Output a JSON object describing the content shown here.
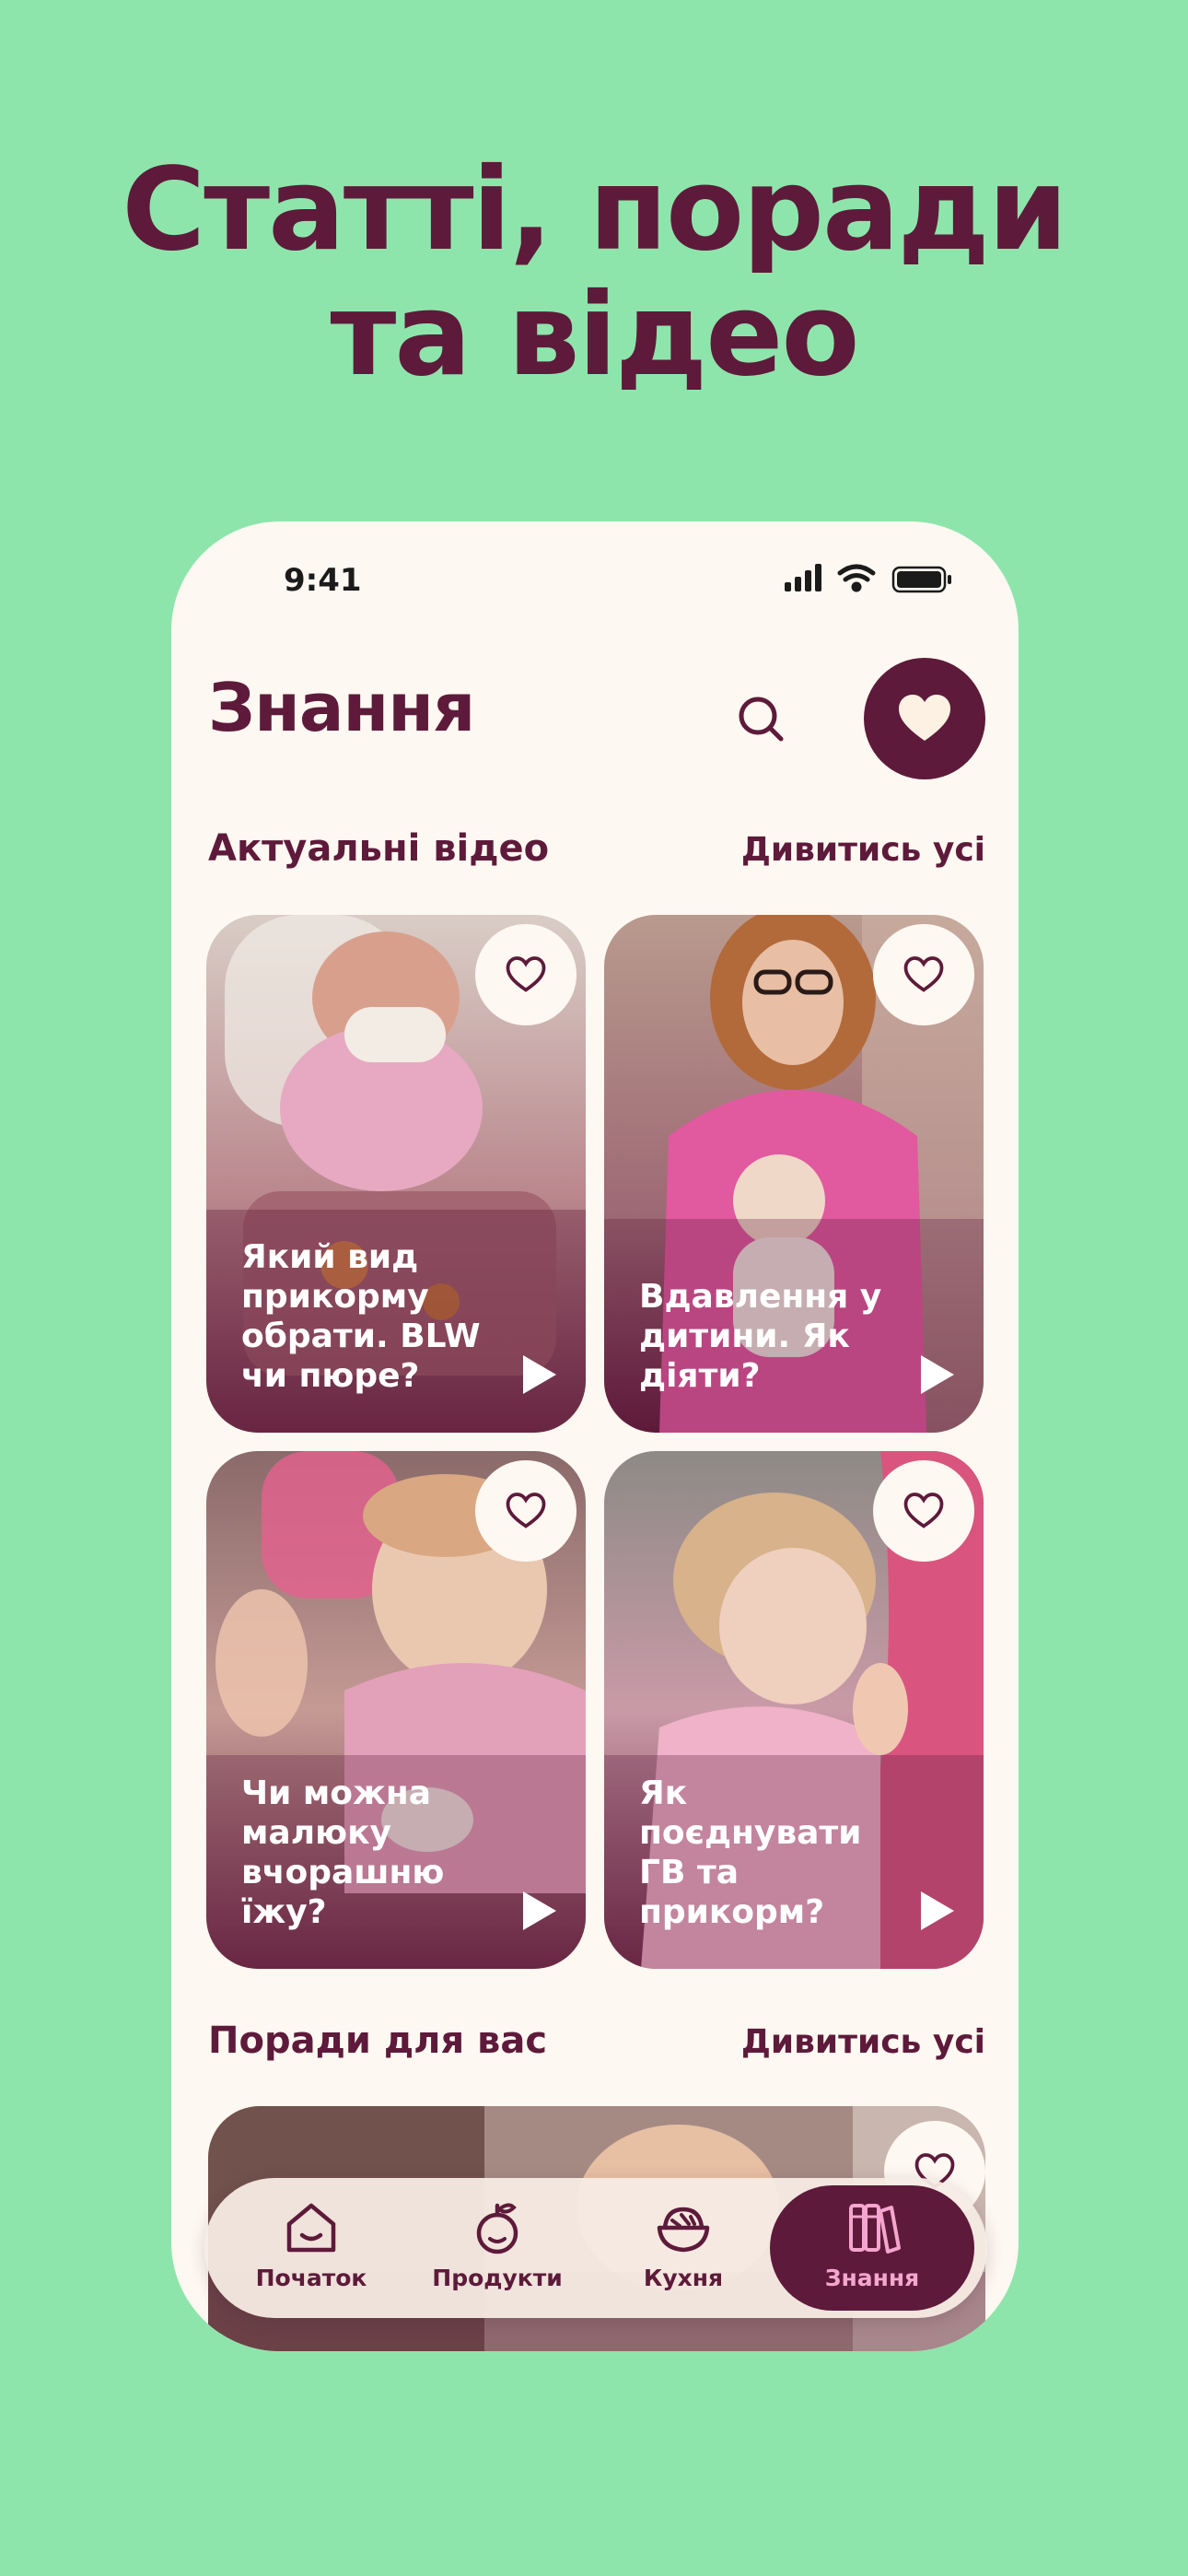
{
  "promo": {
    "title_line1": "Статті, поради",
    "title_line2": "та відео"
  },
  "status_bar": {
    "time": "9:41"
  },
  "header": {
    "title": "Знання",
    "search_icon": "search-icon",
    "favorites_icon": "heart-icon"
  },
  "videos_section": {
    "title": "Актуальні відео",
    "see_all": "Дивитись усі",
    "cards": [
      {
        "title": "Який вид прикорму обрати. BLW чи пюре?"
      },
      {
        "title": "Вдавлення у дитини. Як діяти?"
      },
      {
        "title": "Чи можна малюку вчорашню їжу?"
      },
      {
        "title": "Як поєднувати ГВ та прикорм?"
      }
    ]
  },
  "tips_section": {
    "title": "Поради для вас",
    "see_all": "Дивитись усі"
  },
  "tab_bar": {
    "tabs": [
      {
        "label": "Початок",
        "icon": "home-icon"
      },
      {
        "label": "Продукти",
        "icon": "apple-icon"
      },
      {
        "label": "Кухня",
        "icon": "bowl-icon"
      },
      {
        "label": "Знання",
        "icon": "books-icon",
        "active": true
      }
    ]
  },
  "colors": {
    "background": "#8ee5ac",
    "brand": "#5e1a3a",
    "accent_pink": "#f4a6cf",
    "surface": "#fdf8f1"
  }
}
